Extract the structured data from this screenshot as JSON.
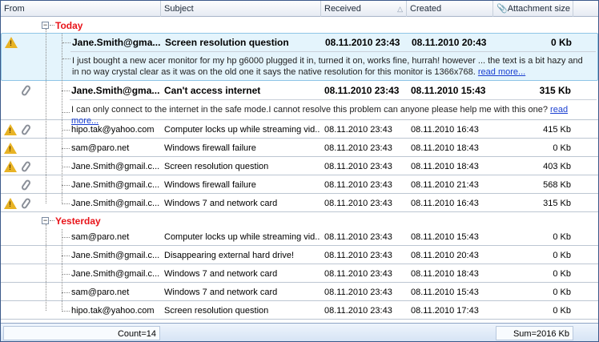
{
  "columns": {
    "from": "From",
    "subject": "Subject",
    "received": "Received",
    "created": "Created",
    "attachment": "Attachment size"
  },
  "groups": [
    {
      "label": "Today",
      "rows": [
        {
          "warn": true,
          "clip": false,
          "from": "Jane.Smith@gma...",
          "subject": "Screen resolution question",
          "received": "08.11.2010 23:43",
          "created": "08.11.2010 20:43",
          "size": "0 Kb",
          "bold": true,
          "selected": true,
          "preview": "I just bought a new acer monitor for my hp g6000 plugged it in, turned it on, works fine, hurrah! however ... the text is a bit hazy and in no way crystal clear as it was on the old one it says the native resolution for this monitor is 1366x768.",
          "link": "read more..."
        },
        {
          "warn": false,
          "clip": true,
          "from": "Jane.Smith@gma...",
          "subject": "Can't access internet",
          "received": "08.11.2010 23:43",
          "created": "08.11.2010 15:43",
          "size": "315 Kb",
          "bold": true,
          "preview": "I can only connect to the internet in the safe mode.I cannot resolve this problem can anyone please help me with this one?",
          "link": "read more..."
        },
        {
          "warn": true,
          "clip": true,
          "from": "hipo.tak@yahoo.com",
          "subject": "Computer locks up while streaming vid...",
          "received": "08.11.2010 23:43",
          "created": "08.11.2010 16:43",
          "size": "415 Kb"
        },
        {
          "warn": true,
          "clip": false,
          "from": "sam@paro.net",
          "subject": "Windows firewall failure",
          "received": "08.11.2010 23:43",
          "created": "08.11.2010 18:43",
          "size": "0 Kb"
        },
        {
          "warn": true,
          "clip": true,
          "from": "Jane.Smith@gmail.c...",
          "subject": "Screen resolution question",
          "received": "08.11.2010 23:43",
          "created": "08.11.2010 18:43",
          "size": "403 Kb"
        },
        {
          "warn": false,
          "clip": true,
          "from": "Jane.Smith@gmail.c...",
          "subject": "Windows firewall failure",
          "received": "08.11.2010 23:43",
          "created": "08.11.2010 21:43",
          "size": "568 Kb"
        },
        {
          "warn": true,
          "clip": true,
          "from": "Jane.Smith@gmail.c...",
          "subject": "Windows 7 and network card",
          "received": "08.11.2010 23:43",
          "created": "08.11.2010 16:43",
          "size": "315 Kb"
        }
      ]
    },
    {
      "label": "Yesterday",
      "rows": [
        {
          "warn": false,
          "clip": false,
          "from": "sam@paro.net",
          "subject": "Computer locks up while streaming vid...",
          "received": "08.11.2010 23:43",
          "created": "08.11.2010 15:43",
          "size": "0 Kb"
        },
        {
          "warn": false,
          "clip": false,
          "from": "Jane.Smith@gmail.c...",
          "subject": "Disappearing external hard drive!",
          "received": "08.11.2010 23:43",
          "created": "08.11.2010 20:43",
          "size": "0 Kb"
        },
        {
          "warn": false,
          "clip": false,
          "from": "Jane.Smith@gmail.c...",
          "subject": "Windows 7 and network card",
          "received": "08.11.2010 23:43",
          "created": "08.11.2010 18:43",
          "size": "0 Kb"
        },
        {
          "warn": false,
          "clip": false,
          "from": "sam@paro.net",
          "subject": "Windows 7 and network card",
          "received": "08.11.2010 23:43",
          "created": "08.11.2010 15:43",
          "size": "0 Kb"
        },
        {
          "warn": false,
          "clip": false,
          "from": "hipo.tak@yahoo.com",
          "subject": "Screen resolution question",
          "received": "08.11.2010 23:43",
          "created": "08.11.2010 17:43",
          "size": "0 Kb"
        }
      ]
    }
  ],
  "footer": {
    "count": "Count=14",
    "sum": "Sum=2016 Kb"
  }
}
